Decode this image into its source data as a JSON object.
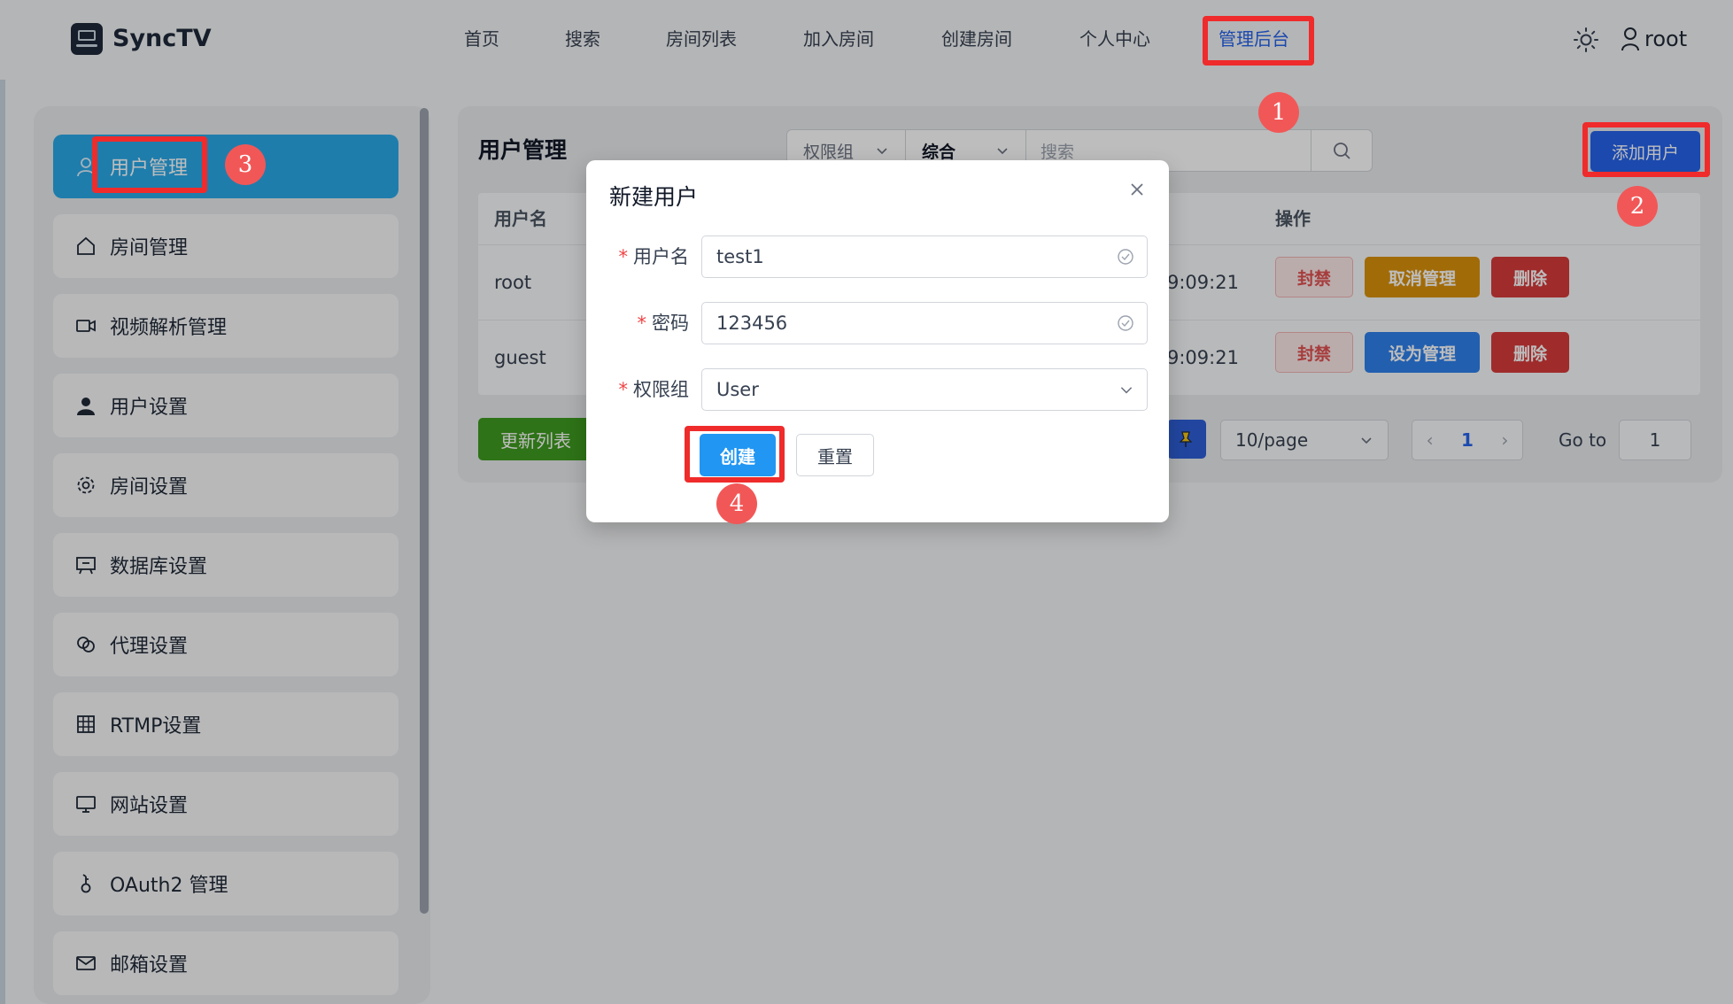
{
  "app": {
    "name": "SyncTV"
  },
  "nav": {
    "items": [
      "首页",
      "搜索",
      "房间列表",
      "加入房间",
      "创建房间",
      "个人中心",
      "管理后台"
    ],
    "active_index": 6,
    "user": "root"
  },
  "sidebar": {
    "items": [
      {
        "label": "用户管理",
        "icon": "user-outline-icon"
      },
      {
        "label": "房间管理",
        "icon": "home-icon"
      },
      {
        "label": "视频解析管理",
        "icon": "video-camera-icon"
      },
      {
        "label": "用户设置",
        "icon": "user-filled-icon"
      },
      {
        "label": "房间设置",
        "icon": "gear-icon"
      },
      {
        "label": "数据库设置",
        "icon": "presentation-icon"
      },
      {
        "label": "代理设置",
        "icon": "link-icon"
      },
      {
        "label": "RTMP设置",
        "icon": "grid-icon"
      },
      {
        "label": "网站设置",
        "icon": "monitor-icon"
      },
      {
        "label": "OAuth2 管理",
        "icon": "key-icon"
      },
      {
        "label": "邮箱设置",
        "icon": "mail-icon"
      }
    ],
    "active_index": 0
  },
  "main": {
    "title": "用户管理",
    "filter": {
      "role": "权限组",
      "sort": "综合",
      "search_placeholder": "搜索"
    },
    "add_button": "添加用户",
    "table": {
      "headers": {
        "username": "用户名",
        "actions": "操作"
      },
      "rows": [
        {
          "username": "root",
          "time": "9:09:21",
          "ban": "封禁",
          "admin": "取消管理",
          "delete": "删除"
        },
        {
          "username": "guest",
          "time": "9:09:21",
          "ban": "封禁",
          "admin": "设为管理",
          "delete": "删除"
        }
      ]
    },
    "refresh_button": "更新列表",
    "pagination": {
      "page_size": "10/page",
      "current": "1",
      "goto_label": "Go to",
      "goto_value": "1"
    }
  },
  "modal": {
    "title": "新建用户",
    "fields": {
      "username": {
        "label": "用户名",
        "value": "test1"
      },
      "password": {
        "label": "密码",
        "value": "123456"
      },
      "role": {
        "label": "权限组",
        "value": "User"
      }
    },
    "required_mark": "*",
    "create_button": "创建",
    "reset_button": "重置"
  },
  "annotations": [
    "1",
    "2",
    "3",
    "4"
  ],
  "colors": {
    "highlight": "#ef2b2b",
    "badge": "#f25757",
    "primary": "#2563eb",
    "sidebar_active": "#2aa9e8"
  }
}
